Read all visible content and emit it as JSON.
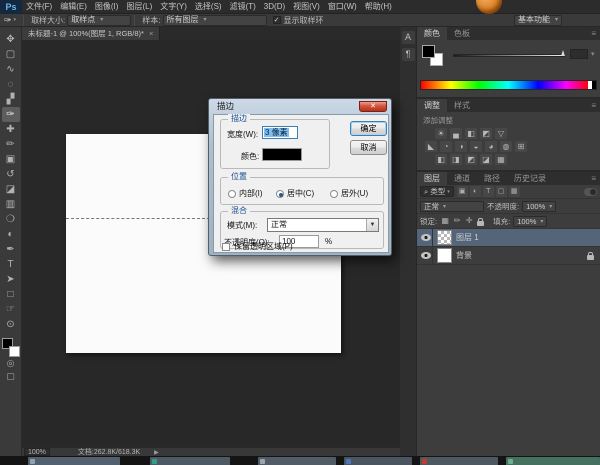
{
  "app": {
    "logo_text": "Ps"
  },
  "menu_bar": {
    "items": [
      "文件(F)",
      "编辑(E)",
      "图像(I)",
      "图层(L)",
      "文字(Y)",
      "选择(S)",
      "滤镜(T)",
      "3D(D)",
      "视图(V)",
      "窗口(W)",
      "帮助(H)"
    ]
  },
  "options_bar": {
    "tool_icon": "eyedropper",
    "sample_size_label": "取样大小:",
    "sample_size_value": "取样点",
    "sample_label": "样本:",
    "sample_value": "所有图层",
    "show_sample_ring_label": "显示取样环",
    "show_sample_ring_checked": "✓",
    "workspace_value": "基本功能"
  },
  "document_tab": {
    "label": "未标题-1 @ 100%(图层 1, RGB/8)*",
    "close": "×"
  },
  "toolbar": {
    "tools": [
      {
        "name": "move-tool",
        "glyph": "✥"
      },
      {
        "name": "rectangular-marquee-tool",
        "glyph": "▢"
      },
      {
        "name": "lasso-tool",
        "glyph": "∿"
      },
      {
        "name": "quick-selection-tool",
        "glyph": "◌"
      },
      {
        "name": "crop-tool",
        "glyph": "▞"
      },
      {
        "name": "eyedropper-tool",
        "glyph": "✑"
      },
      {
        "name": "spot-healing-brush-tool",
        "glyph": "✚"
      },
      {
        "name": "brush-tool",
        "glyph": "✏"
      },
      {
        "name": "clone-stamp-tool",
        "glyph": "▣"
      },
      {
        "name": "history-brush-tool",
        "glyph": "↺"
      },
      {
        "name": "eraser-tool",
        "glyph": "◪"
      },
      {
        "name": "gradient-tool",
        "glyph": "▥"
      },
      {
        "name": "blur-tool",
        "glyph": "❍"
      },
      {
        "name": "dodge-tool",
        "glyph": "◐"
      },
      {
        "name": "pen-tool",
        "glyph": "✒"
      },
      {
        "name": "type-tool",
        "glyph": "T"
      },
      {
        "name": "path-selection-tool",
        "glyph": "➤"
      },
      {
        "name": "rectangle-tool",
        "glyph": "□"
      },
      {
        "name": "hand-tool",
        "glyph": "☞"
      },
      {
        "name": "zoom-tool",
        "glyph": "⊙"
      }
    ]
  },
  "dialog": {
    "title": "描边",
    "close": "✕",
    "ok_label": "确定",
    "cancel_label": "取消",
    "stroke_group": {
      "legend": "描边",
      "width_label": "宽度(W):",
      "width_value": "3 像素",
      "color_label": "颜色:",
      "color_value_hex": "#000000"
    },
    "position_group": {
      "legend": "位置",
      "options": [
        {
          "label": "内部(I)",
          "selected": false
        },
        {
          "label": "居中(C)",
          "selected": true
        },
        {
          "label": "居外(U)",
          "selected": false
        }
      ]
    },
    "blend_group": {
      "legend": "混合",
      "mode_label": "模式(M):",
      "mode_value": "正常",
      "opacity_label": "不透明度(O):",
      "opacity_value": "100",
      "percent_label": "%",
      "preserve_label": "保留透明区域(P)"
    }
  },
  "panels": {
    "dock_icons": [
      {
        "name": "character-panel-icon",
        "glyph": "A"
      },
      {
        "name": "paragraph-panel-icon",
        "glyph": "¶"
      }
    ],
    "color": {
      "tabs": [
        "颜色",
        "色板"
      ],
      "menu_icon": "≡",
      "foreground_hex": "#000000",
      "background_hex": "#ffffff"
    },
    "adjustments": {
      "tabs": [
        "调整",
        "样式"
      ],
      "menu_icon": "≡",
      "add_adjustment_label": "添加调整",
      "icon_rows": [
        [
          "☀",
          "▄",
          "◧",
          "◩",
          "▽"
        ],
        [
          "◣",
          "◔",
          "◑",
          "◒",
          "◕",
          "◍",
          "⊞"
        ],
        [
          "◧",
          "◨",
          "◩",
          "◪",
          "▦"
        ]
      ]
    },
    "layers": {
      "tabs": [
        "图层",
        "通道",
        "路径",
        "历史记录"
      ],
      "menu_icon": "≡",
      "filter": {
        "kind_label": "类型",
        "search_icon": "⌕",
        "icons": [
          {
            "name": "filter-pixel-layers-icon",
            "glyph": "▣"
          },
          {
            "name": "filter-adjustment-layers-icon",
            "glyph": "◐"
          },
          {
            "name": "filter-type-layers-icon",
            "glyph": "T"
          },
          {
            "name": "filter-shape-layers-icon",
            "glyph": "▢"
          },
          {
            "name": "filter-smart-objects-icon",
            "glyph": "▦"
          }
        ]
      },
      "blend_mode_value": "正常",
      "opacity_label": "不透明度:",
      "opacity_value": "100%",
      "lock_label": "锁定:",
      "lock_icons": [
        "▦",
        "✏",
        "✛"
      ],
      "fill_label": "填充:",
      "fill_value": "100%",
      "rows": [
        {
          "name": "图层 1",
          "selected": true,
          "thumb": "checker"
        },
        {
          "name": "背景",
          "selected": false,
          "thumb": "white",
          "locked": true
        }
      ]
    }
  },
  "status_bar": {
    "zoom_value": "100%",
    "doc_info": "文档:262.8K/618.3K",
    "arrow": "▶"
  }
}
